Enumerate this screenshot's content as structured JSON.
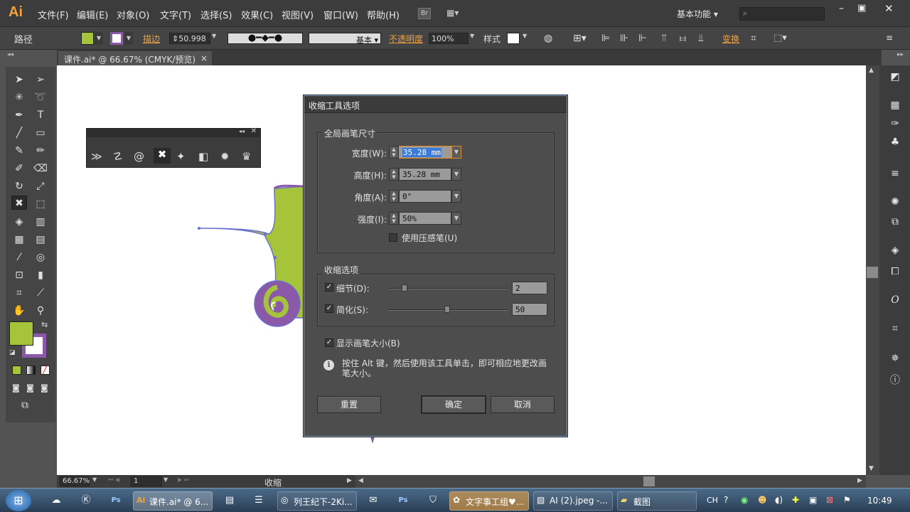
{
  "app": {
    "logo": "Ai"
  },
  "menu": [
    "文件(F)",
    "编辑(E)",
    "对象(O)",
    "文字(T)",
    "选择(S)",
    "效果(C)",
    "视图(V)",
    "窗口(W)",
    "帮助(H)"
  ],
  "bridge_label": "Br",
  "workspace": "基本功能",
  "control": {
    "object_type": "路径",
    "stroke_label": "描边",
    "stroke_value": "50.998",
    "profile_label": "基本",
    "opacity_label": "不透明度",
    "opacity_value": "100%",
    "style_label": "样式",
    "transform_label": "变换",
    "fill_color": "#a6c43a",
    "stroke_color": "#8a5aa8"
  },
  "document_tab": {
    "title": "课件.ai* @ 66.67% (CMYK/预览)",
    "close": "×"
  },
  "status": {
    "zoom": "66.67%",
    "page": "1",
    "tool": "收缩"
  },
  "dialog": {
    "title": "收缩工具选项",
    "brush_group": "全局画笔尺寸",
    "width_label": "宽度(W):",
    "width_value": "35.28 mm",
    "height_label": "高度(H):",
    "height_value": "35.28 mm",
    "angle_label": "角度(A):",
    "angle_value": "0°",
    "intensity_label": "强度(I):",
    "intensity_value": "50%",
    "pressure_label": "使用压感笔(U)",
    "pressure_checked": false,
    "options_group": "收缩选项",
    "detail_label": "细节(D):",
    "detail_value": "2",
    "detail_checked": true,
    "simplify_label": "简化(S):",
    "simplify_value": "50",
    "simplify_checked": true,
    "show_size_label": "显示画笔大小(B)",
    "show_size_checked": true,
    "hint": "按住 Alt 键，然后使用该工具单击，即可相应地更改画笔大小。",
    "reset": "重置",
    "ok": "确定",
    "cancel": "取消"
  },
  "taskbar": {
    "items": [
      "课件.ai* @ 6...",
      "列王纪下-2Ki...",
      "文字事工组♥...",
      "AI (2).jpeg -...",
      "截图"
    ],
    "lang": "CH",
    "clock": "10:49"
  }
}
